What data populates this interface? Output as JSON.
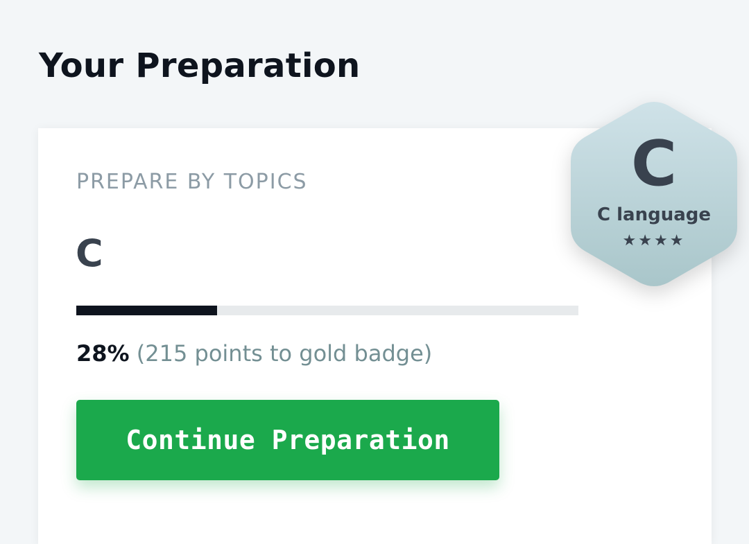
{
  "header": {
    "title": "Your Preparation"
  },
  "card": {
    "eyebrow": "PREPARE BY TOPICS",
    "topic": "C",
    "progress": {
      "percent_value": 28,
      "percent_label": "28%",
      "note": "(215 points to gold badge)"
    },
    "button_label": "Continue Preparation"
  },
  "badge": {
    "icon": "hexagon-badge-icon",
    "letter": "C",
    "name": "C language",
    "stars": "★★★★",
    "star_count": 4
  },
  "colors": {
    "background": "#f3f6f8",
    "title": "#0e141e",
    "eyebrow": "#8c9ba5",
    "topic": "#39424e",
    "progress_fill": "#0e141e",
    "progress_track": "#e7eaec",
    "note": "#738f93",
    "button": "#1ba94c",
    "badge_top": "#cfe2e8",
    "badge_bottom": "#a9c6ca"
  }
}
